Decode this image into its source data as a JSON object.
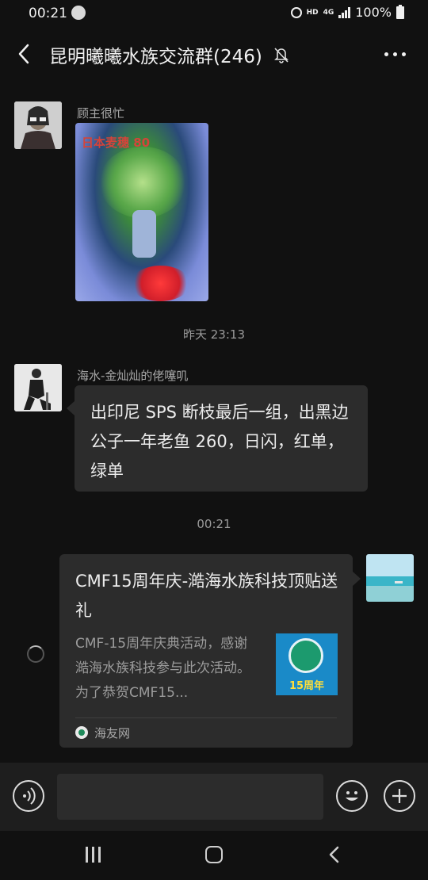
{
  "status": {
    "time": "00:21",
    "network": "HD",
    "network_type": "4G",
    "battery": "100%"
  },
  "header": {
    "title": "昆明曦曦水族交流群(246)"
  },
  "messages": {
    "msg1": {
      "sender": "顾主很忙",
      "image_caption": "日本麦穗 80"
    },
    "time_separator_1": "昨天 23:13",
    "msg2": {
      "sender": "海水-金灿灿的佬噻叽",
      "text": "出印尼 SPS 断枝最后一组，出黑边公子一年老鱼 260，日闪，红单，绿单"
    },
    "time_separator_2": "00:21",
    "msg3": {
      "card_title": "CMF15周年庆-澔海水族科技顶贴送礼",
      "card_description": "CMF-15周年庆典活动，感谢澔海水族科技参与此次活动。为了恭贺CMF15...",
      "thumbnail_text": "15周年",
      "source": "海友网"
    }
  },
  "input": {
    "placeholder": ""
  },
  "colors": {
    "background": "#111111",
    "bubble": "#2c2c2c",
    "secondary_text": "#9a9a9a"
  },
  "icons": [
    "back-icon",
    "mute-icon",
    "more-icon",
    "voice-icon",
    "emoji-icon",
    "plus-icon",
    "nav-recent-icon",
    "nav-home-icon",
    "nav-back-icon"
  ]
}
